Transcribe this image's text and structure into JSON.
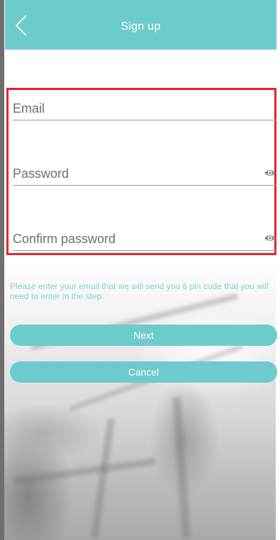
{
  "header": {
    "title": "Sign up",
    "back_icon": "chevron-left-icon"
  },
  "form": {
    "email_placeholder": "Email",
    "password_placeholder": "Password",
    "confirm_password_placeholder": "Confirm password",
    "password_visibility_icon": "eye-icon",
    "confirm_visibility_icon": "eye-icon",
    "highlight_color": "#e32430"
  },
  "hint": "Please enter your email that we will send you 6 pin code that you will need to enter in the step.",
  "buttons": {
    "next_label": "Next",
    "cancel_label": "Cancel"
  },
  "colors": {
    "accent": "#6ecbcc",
    "hint_text": "#7fd3d4"
  }
}
